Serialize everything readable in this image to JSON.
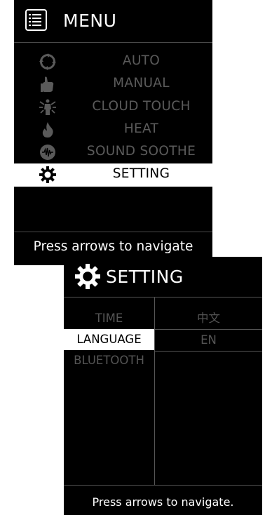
{
  "menu_screen": {
    "title": "MENU",
    "header_icon": "menu-list-icon",
    "items": [
      {
        "label": "AUTO",
        "icon": "auto-cycle-icon",
        "active": false
      },
      {
        "label": "MANUAL",
        "icon": "hand-icon",
        "active": false
      },
      {
        "label": "CLOUD TOUCH",
        "icon": "body-figure-icon",
        "active": false
      },
      {
        "label": "HEAT",
        "icon": "flame-icon",
        "active": false
      },
      {
        "label": "SOUND SOOTHE",
        "icon": "soundwave-icon",
        "active": false
      },
      {
        "label": "SETTING",
        "icon": "gear-icon",
        "active": true
      }
    ],
    "footer": "Press arrows to navigate"
  },
  "setting_screen": {
    "title": "SETTING",
    "header_icon": "gear-icon",
    "left_items": [
      {
        "label": "TIME",
        "active": false
      },
      {
        "label": "LANGUAGE",
        "active": true
      },
      {
        "label": "BLUETOOTH",
        "active": false
      }
    ],
    "right_items": [
      {
        "label": "中文"
      },
      {
        "label": "EN"
      }
    ],
    "footer": "Press arrows to navigate."
  },
  "colors": {
    "background": "#000000",
    "active_highlight": "#ffffff",
    "inactive_text": "#5a5a5a",
    "divider": "#4a4a4a"
  }
}
